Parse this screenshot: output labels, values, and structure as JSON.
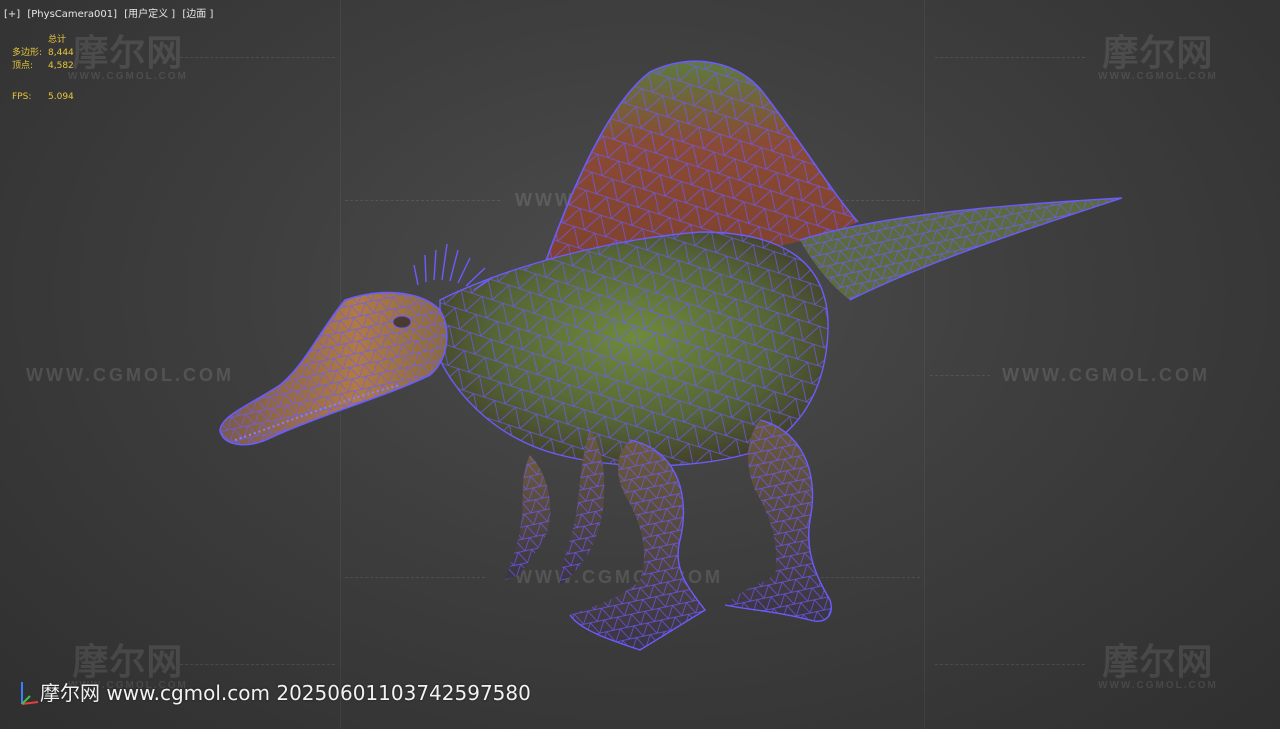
{
  "viewport": {
    "labels": [
      "[+]",
      "[PhysCamera001]",
      "[用户定义 ]",
      "[边面 ]"
    ]
  },
  "stats": {
    "header": "总计",
    "polygons_label": "多边形:",
    "polygons_value": "8,444",
    "vertices_label": "顶点:",
    "vertices_value": "4,582",
    "fps_label": "FPS:",
    "fps_value": "5.094"
  },
  "watermark": {
    "logo_text": "摩尔网",
    "logo_sub": "WWW.CGMOL.COM",
    "url_text": "WWW.CGMOL.COM"
  },
  "footer": {
    "text": "摩尔网 www.cgmol.com 20250601103742597580"
  },
  "colors": {
    "wireframe": "#6a5cff",
    "stats_text": "#e8c73c",
    "background": "#3e3e3e"
  }
}
